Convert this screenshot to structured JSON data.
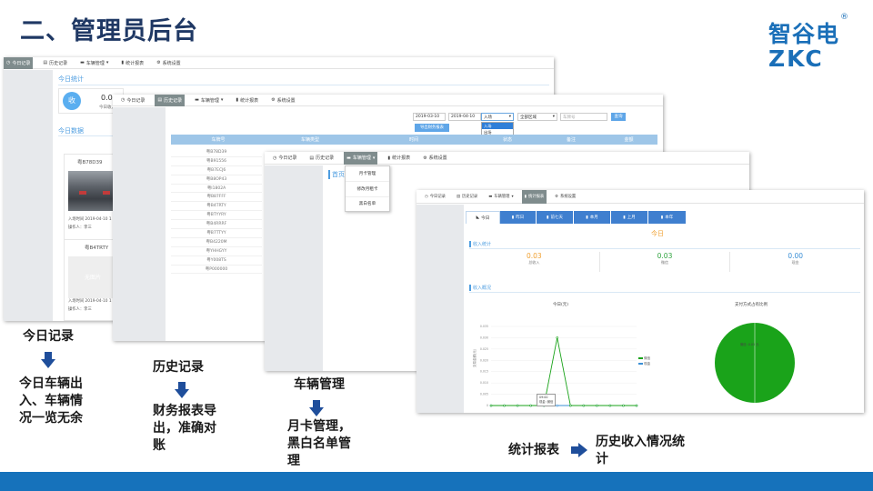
{
  "slide_title": "二、管理员后台",
  "logo": {
    "cn": "智谷电",
    "en": "ZKC",
    "registered": "®"
  },
  "nav_items": [
    "今日记录",
    "历史记录",
    "车辆管理",
    "统计报表",
    "系统设置"
  ],
  "shot1": {
    "section_today_stats": "今日统计",
    "stat_icon": "收",
    "stat_value": "0.0(",
    "stat_label": "今日收入",
    "section_today_data": "今日数据",
    "card1": {
      "plate": "粤B78D39",
      "entry_time": "入场时间 2019-04-10 1",
      "operator": "操作人：李三"
    },
    "card2": {
      "plate": "粤B4TRTY",
      "placeholder": "无图片",
      "entry_time": "入场时间 2019-04-10 1",
      "operator": "操作人：李三"
    }
  },
  "shot2": {
    "date_from": "2019-03-10",
    "date_to": "2019-04-10",
    "type_select": "入场",
    "area_select": "全部区域",
    "plate_placeholder": "车牌号",
    "search_btn": "查询",
    "export_btn": "导出财务报表",
    "dropdown_options": [
      "入场",
      "出场",
      "所记财务"
    ],
    "columns": [
      "车牌号",
      "车辆类型",
      "时间",
      "状态",
      "备注",
      "金额"
    ],
    "plates": [
      "粤B78D39",
      "粤B91556",
      "粤B7ECJ6",
      "粤B8OP43",
      "粤I1802A",
      "粤B87FFF",
      "粤B4TRTY",
      "粤BTYYRY",
      "粤B4RRRF",
      "粤B7TTYY",
      "粤B4220M",
      "粤YHHGYY",
      "粤Y008TS",
      "粤P000000"
    ]
  },
  "shot3": {
    "breadcrumb": "首页",
    "menu": [
      "月卡管理",
      "修改月租卡",
      "黑白名单"
    ]
  },
  "shot4": {
    "tabs": [
      "今日",
      "昨日",
      "前七天",
      "本月",
      "上月",
      "本年"
    ],
    "heading": "今日",
    "income_section": "收入统计",
    "stats": [
      {
        "value": "0.03",
        "label": "总收入",
        "color": "#f0a030"
      },
      {
        "value": "0.03",
        "label": "微信",
        "color": "#2fa33f"
      },
      {
        "value": "0.00",
        "label": "现金",
        "color": "#3a8fd6"
      }
    ],
    "overview_section": "收入概况",
    "line_title": "今日(元)",
    "pie_title": "支付方式占有比例",
    "y_axis_label": "交易金额(元)",
    "y_ticks": [
      "0.035",
      "0.030",
      "0.025",
      "0.020",
      "0.015",
      "0.010",
      "0.005",
      "0"
    ],
    "legend": [
      "微信",
      "现金"
    ],
    "tooltip": [
      "09:00",
      "现金: 微信"
    ],
    "pie_label": "微信: 0.03 元"
  },
  "chart_data": [
    {
      "type": "line",
      "title": "今日(元)",
      "ylabel": "交易金额(元)",
      "ylim": [
        0,
        0.035
      ],
      "series": [
        {
          "name": "微信",
          "values": [
            0,
            0,
            0,
            0,
            0,
            0.03,
            0,
            0,
            0,
            0,
            0,
            0
          ]
        },
        {
          "name": "现金",
          "values": [
            0,
            0,
            0,
            0,
            0,
            0,
            0,
            0,
            0,
            0,
            0,
            0
          ]
        }
      ]
    },
    {
      "type": "pie",
      "title": "支付方式占有比例",
      "categories": [
        "微信",
        "现金"
      ],
      "values": [
        0.03,
        0.0
      ]
    }
  ],
  "labels": {
    "today": "今日记录",
    "today_desc": "今日车辆出入、车辆情况一览无余",
    "history": "历史记录",
    "history_desc": "财务报表导出，准确对账",
    "vehicle": "车辆管理",
    "vehicle_desc": "月卡管理，黑白名单管理",
    "stats": "统计报表",
    "stats_desc": "历史收入情况统计"
  },
  "colors": {
    "title": "#1f3864",
    "brand": "#1a6fb8",
    "arrow": "#1f4e9b",
    "bar": "#1672bb",
    "wechat": "#1aa31a"
  }
}
